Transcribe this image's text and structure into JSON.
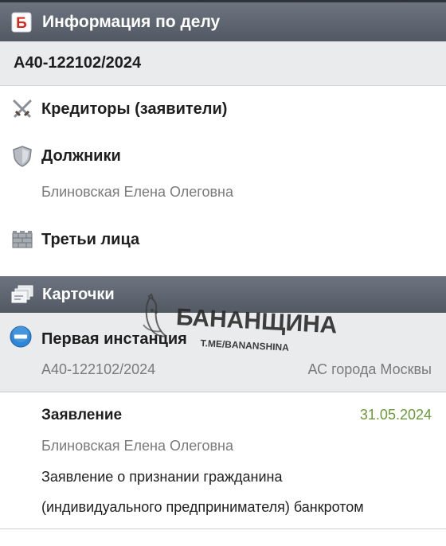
{
  "header": {
    "title": "Информация по делу",
    "icon": "bankruptcy-b-icon"
  },
  "case": {
    "number": "А40-122102/2024"
  },
  "creditors": {
    "label": "Кредиторы (заявители)",
    "icon": "crossed-swords-icon"
  },
  "debtors": {
    "label": "Должники",
    "icon": "shield-icon",
    "name": "Блиновская Елена Олеговна"
  },
  "third_parties": {
    "label": "Третьи лица",
    "icon": "wall-icon"
  },
  "cards": {
    "title": "Карточки",
    "icon": "cards-icon"
  },
  "first_instance": {
    "label": "Первая инстанция",
    "icon": "collapse-minus-icon",
    "case_number": "А40-122102/2024",
    "court": "АС города Москвы"
  },
  "application": {
    "title": "Заявление",
    "date": "31.05.2024",
    "party": "Блиновская Елена Олеговна",
    "description_line1": "Заявление о признании гражданина",
    "description_line2": "(индивидуального предпринимателя) банкротом"
  },
  "watermark": {
    "title": "БАНАНЩИНА",
    "handle": "T.ME/BANANSHINA"
  },
  "colors": {
    "header_bg": "#5d646e",
    "band_bg": "#eaebed",
    "date_green": "#6a9a3a",
    "icon_red": "#d42a1e",
    "minus_blue": "#2f86d6"
  }
}
